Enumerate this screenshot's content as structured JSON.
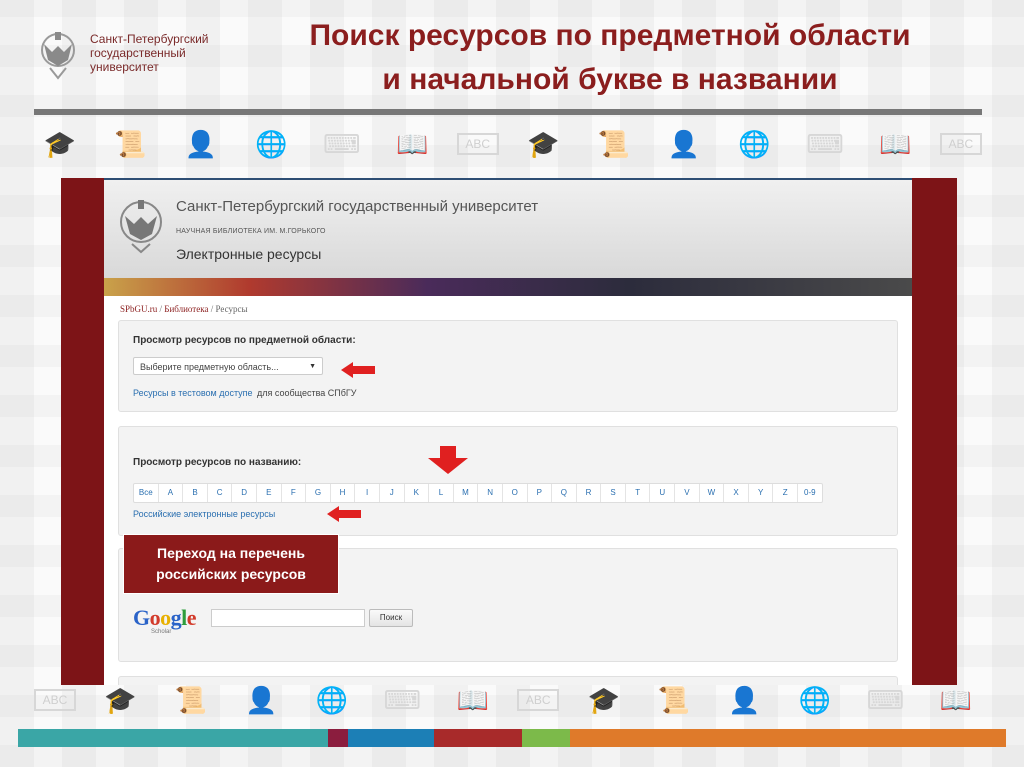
{
  "slide": {
    "logo_text": "Санкт-Петербургский государственный университет",
    "title_line1": "Поиск ресурсов по предметной области",
    "title_line2": "и начальной букве в названии",
    "callout": "Переход на перечень российских ресурсов"
  },
  "site": {
    "title": "Санкт-Петербургский государственный университет",
    "subtitle": "НАУЧНАЯ БИБЛИОТЕКА ИМ. М.ГОРЬКОГО",
    "section": "Электронные ресурсы",
    "breadcrumb": [
      "SPbGU.ru",
      "Библиотека",
      "Ресурсы"
    ],
    "breadcrumb_sep": "/"
  },
  "subject_panel": {
    "heading": "Просмотр ресурсов по предметной области:",
    "select_value": "Выберите предметную область...",
    "trial_link": "Ресурсы в тестовом доступе",
    "trial_suffix": "для сообщества СПбГУ"
  },
  "name_panel": {
    "heading": "Просмотр ресурсов по названию:",
    "letters": [
      "Все",
      "A",
      "B",
      "C",
      "D",
      "E",
      "F",
      "G",
      "H",
      "I",
      "J",
      "K",
      "L",
      "M",
      "N",
      "O",
      "P",
      "Q",
      "R",
      "S",
      "T",
      "U",
      "V",
      "W",
      "X",
      "Y",
      "Z",
      "0-9"
    ],
    "russian_link": "Российские электронные ресурсы"
  },
  "google_panel": {
    "logo": "Google",
    "logo_sub": "Scholar",
    "search_value": "",
    "button": "Поиск"
  },
  "colors": {
    "brand_red": "#8b1e1e",
    "frame": "#7d1417",
    "link": "#2a6fb0",
    "arrow": "#e02020"
  }
}
